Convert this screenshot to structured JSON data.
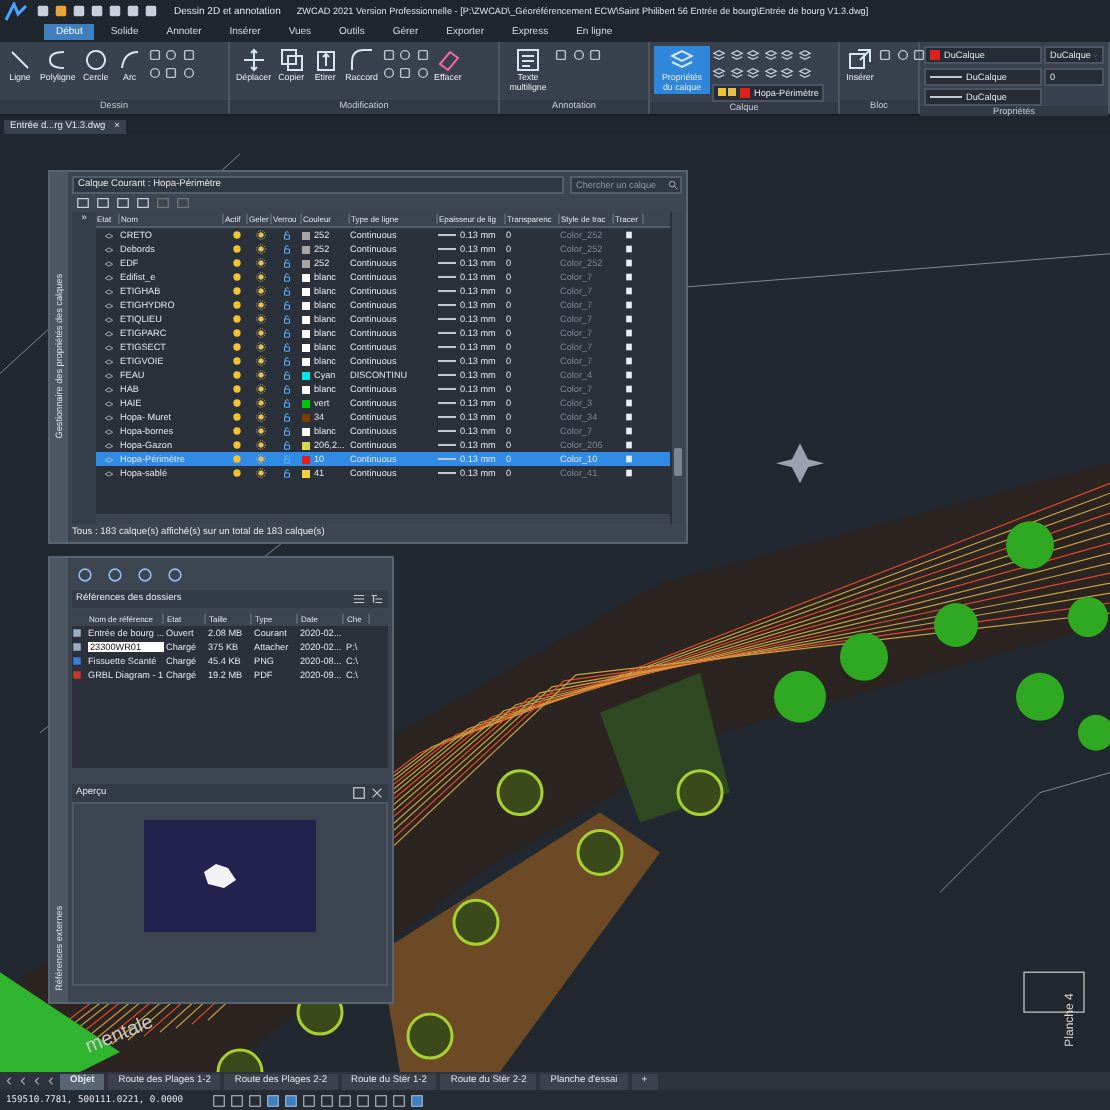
{
  "title_bar": {
    "workspace": "Dessin 2D et annotation",
    "title": "ZWCAD 2021 Version Professionnelle - [P:\\ZWCAD\\_Géoréférencement ECW\\Saint Philibert 56 Entrée de bourg\\Entrée de bourg V1.3.dwg]"
  },
  "menu_tabs": [
    {
      "label": "Début",
      "selected": true
    },
    {
      "label": "Solide",
      "selected": false
    },
    {
      "label": "Annoter",
      "selected": false
    },
    {
      "label": "Insérer",
      "selected": false
    },
    {
      "label": "Vues",
      "selected": false
    },
    {
      "label": "Outils",
      "selected": false
    },
    {
      "label": "Gérer",
      "selected": false
    },
    {
      "label": "Exporter",
      "selected": false
    },
    {
      "label": "Express",
      "selected": false
    },
    {
      "label": "En ligne",
      "selected": false
    }
  ],
  "ribbon": [
    {
      "title": "Dessin",
      "buttons": [
        {
          "label": "Ligne",
          "active": false
        },
        {
          "label": "Polyligne",
          "active": false
        },
        {
          "label": "Cercle",
          "active": false
        },
        {
          "label": "Arc",
          "active": false
        }
      ]
    },
    {
      "title": "Modification",
      "buttons": [
        {
          "label": "Déplacer",
          "active": false
        },
        {
          "label": "Copier",
          "active": false
        },
        {
          "label": "Etirer",
          "active": false
        },
        {
          "label": "Raccord",
          "active": false
        },
        {
          "label": "Effacer",
          "active": false
        }
      ]
    },
    {
      "title": "Annotation",
      "buttons": [
        {
          "label": "Texte multiligne",
          "active": false
        }
      ]
    },
    {
      "title": "Calque",
      "buttons": [
        {
          "label": "Propriétés du calque",
          "active": true
        }
      ],
      "layer": {
        "name": "Hopa-Périmètre",
        "color": "#e0201e"
      }
    },
    {
      "title": "Bloc",
      "buttons": [
        {
          "label": "Insérer",
          "active": false
        }
      ]
    },
    {
      "title": "Propriétés",
      "dropdowns": [
        {
          "kind": "color",
          "value": "DuCalque",
          "color": "#e0201e"
        },
        {
          "kind": "linetype",
          "value": "DuCalque"
        },
        {
          "kind": "lineweight",
          "value": "DuCalque"
        }
      ],
      "extra": [
        {
          "kind": "dropdown",
          "value": "DuCalque"
        },
        {
          "kind": "field",
          "value": "0"
        }
      ]
    }
  ],
  "doc_tab": {
    "label": "Entrée d...rg V1.3.dwg",
    "close": "×"
  },
  "layers": {
    "side_title": "Gestionnaire des propriétés des calques",
    "current": "Calque Courant : Hopa-Périmètre",
    "search_placeholder": "Chercher un calque",
    "filter_toggle": "»",
    "columns": [
      "Etat",
      "Nom",
      "Actif",
      "Geler",
      "Verrou",
      "Couleur",
      "Type de ligne",
      "Epaisseur de lig",
      "Transparenc",
      "Style de trac",
      "Tracer"
    ],
    "rows": [
      {
        "name": "CRETO",
        "color": "#a6a6a6",
        "color_label": "252",
        "linetype": "Continuous",
        "lineweight": "0.13 mm",
        "transparency": "0",
        "plot_style": "Color_252",
        "selected": false
      },
      {
        "name": "Debords",
        "color": "#a6a6a6",
        "color_label": "252",
        "linetype": "Continuous",
        "lineweight": "0.13 mm",
        "transparency": "0",
        "plot_style": "Color_252",
        "selected": false
      },
      {
        "name": "EDF",
        "color": "#a6a6a6",
        "color_label": "252",
        "linetype": "Continuous",
        "lineweight": "0.13 mm",
        "transparency": "0",
        "plot_style": "Color_252",
        "selected": false
      },
      {
        "name": "Edifist_e",
        "color": "#ffffff",
        "color_label": "blanc",
        "linetype": "Continuous",
        "lineweight": "0.13 mm",
        "transparency": "0",
        "plot_style": "Color_7",
        "selected": false
      },
      {
        "name": "ETIGHAB",
        "color": "#ffffff",
        "color_label": "blanc",
        "linetype": "Continuous",
        "lineweight": "0.13 mm",
        "transparency": "0",
        "plot_style": "Color_7",
        "selected": false
      },
      {
        "name": "ETIGHYDRO",
        "color": "#ffffff",
        "color_label": "blanc",
        "linetype": "Continuous",
        "lineweight": "0.13 mm",
        "transparency": "0",
        "plot_style": "Color_7",
        "selected": false
      },
      {
        "name": "ETIQLIEU",
        "color": "#ffffff",
        "color_label": "blanc",
        "linetype": "Continuous",
        "lineweight": "0.13 mm",
        "transparency": "0",
        "plot_style": "Color_7",
        "selected": false
      },
      {
        "name": "ETIGPARC",
        "color": "#ffffff",
        "color_label": "blanc",
        "linetype": "Continuous",
        "lineweight": "0.13 mm",
        "transparency": "0",
        "plot_style": "Color_7",
        "selected": false
      },
      {
        "name": "ETIGSECT",
        "color": "#ffffff",
        "color_label": "blanc",
        "linetype": "Continuous",
        "lineweight": "0.13 mm",
        "transparency": "0",
        "plot_style": "Color_7",
        "selected": false
      },
      {
        "name": "ETIGVOIE",
        "color": "#ffffff",
        "color_label": "blanc",
        "linetype": "Continuous",
        "lineweight": "0.13 mm",
        "transparency": "0",
        "plot_style": "Color_7",
        "selected": false
      },
      {
        "name": "FEAU",
        "color": "#00e5e5",
        "color_label": "Cyan",
        "linetype": "DISCONTINU",
        "lineweight": "0.13 mm",
        "transparency": "0",
        "plot_style": "Color_4",
        "selected": false
      },
      {
        "name": "HAB",
        "color": "#ffffff",
        "color_label": "blanc",
        "linetype": "Continuous",
        "lineweight": "0.13 mm",
        "transparency": "0",
        "plot_style": "Color_7",
        "selected": false
      },
      {
        "name": "HAIE",
        "color": "#00c800",
        "color_label": "vert",
        "linetype": "Continuous",
        "lineweight": "0.13 mm",
        "transparency": "0",
        "plot_style": "Color_3",
        "selected": false
      },
      {
        "name": "Hopa- Muret",
        "color": "#7a3c00",
        "color_label": "34",
        "linetype": "Continuous",
        "lineweight": "0.13 mm",
        "transparency": "0",
        "plot_style": "Color_34",
        "selected": false
      },
      {
        "name": "Hopa-bornes",
        "color": "#ffffff",
        "color_label": "blanc",
        "linetype": "Continuous",
        "lineweight": "0.13 mm",
        "transparency": "0",
        "plot_style": "Color_7",
        "selected": false
      },
      {
        "name": "Hopa-Gazon",
        "color": "#d6d64a",
        "color_label": "206,2...",
        "linetype": "Continuous",
        "lineweight": "0.13 mm",
        "transparency": "0",
        "plot_style": "Color_206",
        "selected": false
      },
      {
        "name": "Hopa-Périmètre",
        "color": "#e0201e",
        "color_label": "10",
        "linetype": "Continuous",
        "lineweight": "0.13 mm",
        "transparency": "0",
        "plot_style": "Color_10",
        "selected": true
      },
      {
        "name": "Hopa-sablé",
        "color": "#f2d23c",
        "color_label": "41",
        "linetype": "Continuous",
        "lineweight": "0.13 mm",
        "transparency": "0",
        "plot_style": "Color_41",
        "selected": false
      }
    ],
    "footer": "Tous : 183 calque(s) affiché(s) sur un total de  183 calque(s)"
  },
  "xrefs": {
    "side_title": "Références externes",
    "header": "Références des dossiers",
    "columns": [
      "Nom de référence",
      "Etat",
      "Taille",
      "Type",
      "Date",
      "Che"
    ],
    "rows": [
      {
        "kind": "dwg",
        "name": "Entrée de bourg ...",
        "status": "Ouvert",
        "size": "2.08 MB",
        "type": "Courant",
        "date": "2020-02...",
        "editing": false
      },
      {
        "kind": "dwg",
        "name": "23300WR01",
        "status": "Chargé",
        "size": "375 KB",
        "type": "Attacher",
        "date": "2020-02...",
        "path": "P:\\",
        "editing": true
      },
      {
        "kind": "image",
        "name": "Fissuette Scanté",
        "status": "Chargé",
        "size": "45.4 KB",
        "type": "PNG",
        "date": "2020-08...",
        "path": "C:\\",
        "editing": false
      },
      {
        "kind": "pdf",
        "name": "GRBL Diagram - 1",
        "status": "Chargé",
        "size": "19.2 MB",
        "type": "PDF",
        "date": "2020-09...",
        "path": "C:\\",
        "editing": false
      }
    ],
    "preview_label": "Aperçu"
  },
  "drawing_labels": [
    {
      "kind": "street",
      "text": "mentale"
    },
    {
      "kind": "sheet",
      "text": "Planche 4"
    }
  ],
  "layout_tabs": [
    {
      "label": "Objet",
      "selected": true
    },
    {
      "label": "Route des Plages 1-2",
      "selected": false
    },
    {
      "label": "Route des Plages 2-2",
      "selected": false
    },
    {
      "label": "Route du Stër 1-2",
      "selected": false
    },
    {
      "label": "Route du Stër 2-2",
      "selected": false
    },
    {
      "label": "Planche d'essai",
      "selected": false
    }
  ],
  "add_tab": "+",
  "status_bar": {
    "coordinates": "159510.7781, 500111.0221, 0.0000"
  }
}
